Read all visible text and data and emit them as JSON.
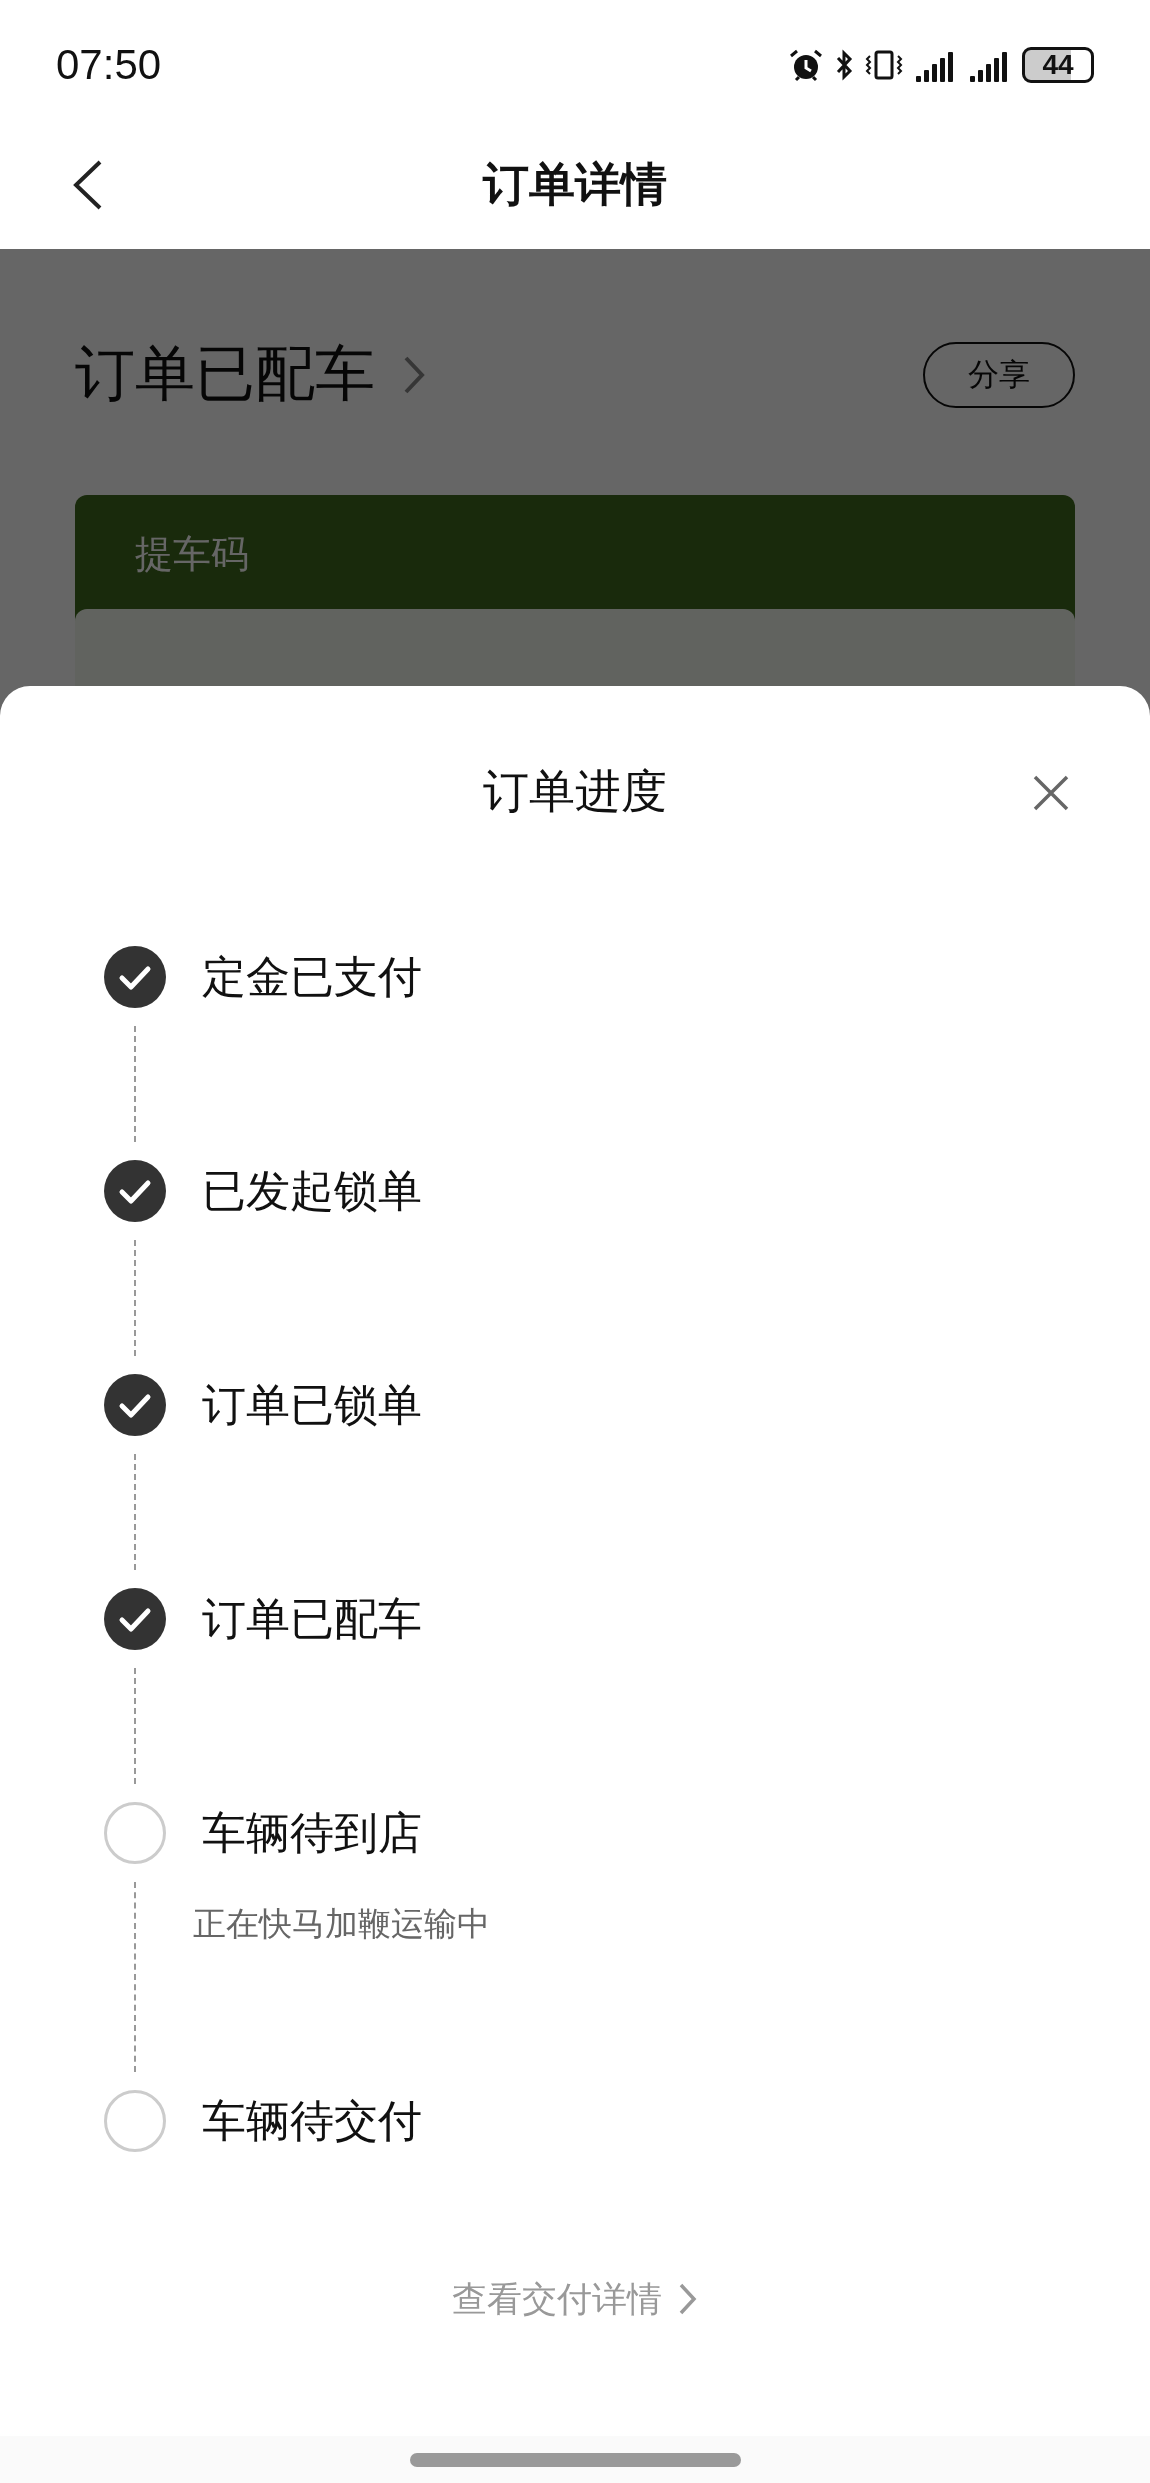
{
  "status_bar": {
    "time": "07:50",
    "battery": "44"
  },
  "nav": {
    "title": "订单详情"
  },
  "page": {
    "heading": "订单已配车",
    "share_button": "分享",
    "card_title": "提车码"
  },
  "sheet": {
    "title": "订单进度",
    "steps": [
      {
        "label": "定金已支付",
        "done": true
      },
      {
        "label": "已发起锁单",
        "done": true
      },
      {
        "label": "订单已锁单",
        "done": true
      },
      {
        "label": "订单已配车",
        "done": true
      },
      {
        "label": "车辆待到店",
        "done": false,
        "note": "正在快马加鞭运输中"
      },
      {
        "label": "车辆待交付",
        "done": false
      }
    ],
    "link": "查看交付详情"
  }
}
